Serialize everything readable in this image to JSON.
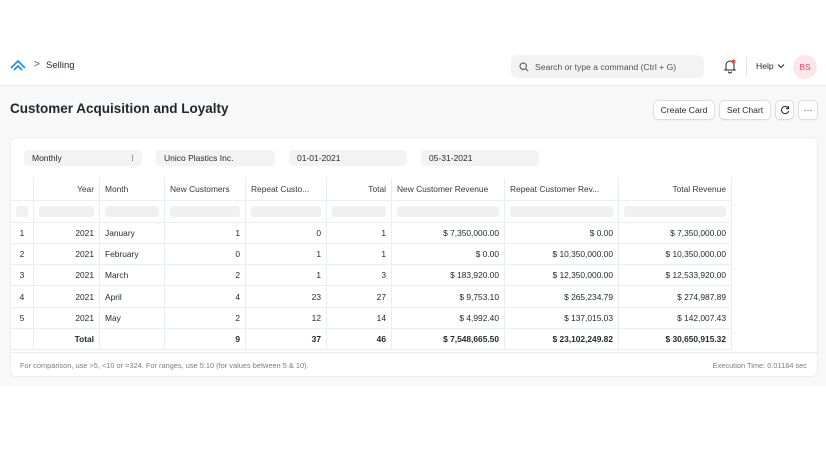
{
  "navbar": {
    "breadcrumb_sep": ">",
    "breadcrumb": "Selling",
    "search_placeholder": "Search or type a command (Ctrl + G)",
    "help_label": "Help",
    "avatar_initials": "BS"
  },
  "page": {
    "title": "Customer Acquisition and Loyalty",
    "buttons": {
      "create_card": "Create Card",
      "set_chart": "Set Chart",
      "more": "···"
    }
  },
  "filters": {
    "period": "Monthly",
    "period_indicator": "⁝",
    "company": "Unico Plastics Inc.",
    "from_date": "01-01-2021",
    "to_date": "05-31-2021"
  },
  "table": {
    "columns": [
      "Year",
      "Month",
      "New Customers",
      "Repeat Custo...",
      "Total",
      "New Customer Revenue",
      "Repeat Customer Rev...",
      "Total Revenue"
    ],
    "rows": [
      {
        "num": "1",
        "year": "2021",
        "month": "January",
        "new": "1",
        "repeat": "0",
        "total": "1",
        "new_rev": "$ 7,350,000.00",
        "repeat_rev": "$ 0.00",
        "total_rev": "$ 7,350,000.00"
      },
      {
        "num": "2",
        "year": "2021",
        "month": "February",
        "new": "0",
        "repeat": "1",
        "total": "1",
        "new_rev": "$ 0.00",
        "repeat_rev": "$ 10,350,000.00",
        "total_rev": "$ 10,350,000.00"
      },
      {
        "num": "3",
        "year": "2021",
        "month": "March",
        "new": "2",
        "repeat": "1",
        "total": "3",
        "new_rev": "$ 183,920.00",
        "repeat_rev": "$ 12,350,000.00",
        "total_rev": "$ 12,533,920.00"
      },
      {
        "num": "4",
        "year": "2021",
        "month": "April",
        "new": "4",
        "repeat": "23",
        "total": "27",
        "new_rev": "$ 9,753.10",
        "repeat_rev": "$ 265,234.79",
        "total_rev": "$ 274,987.89"
      },
      {
        "num": "5",
        "year": "2021",
        "month": "May",
        "new": "2",
        "repeat": "12",
        "total": "14",
        "new_rev": "$ 4,992.40",
        "repeat_rev": "$ 137,015.03",
        "total_rev": "$ 142,007.43"
      }
    ],
    "totals": {
      "label": "Total",
      "new": "9",
      "repeat": "37",
      "total": "46",
      "new_rev": "$ 7,548,665.50",
      "repeat_rev": "$ 23,102,249.82",
      "total_rev": "$ 30,650,915.32"
    }
  },
  "footer": {
    "note": "For comparison, use >5, <10 or =324. For ranges, use 5:10 (for values between 5 & 10).",
    "execution_time": "Execution Time: 0.01184 sec"
  },
  "colors": {
    "avatar_bg": "#fce6ea",
    "avatar_text": "#e24c6e",
    "logo": "#2490ef"
  },
  "icons": [
    "app-logo-icon",
    "search-icon",
    "bell-icon",
    "chevron-down-icon",
    "refresh-icon",
    "more-icon"
  ]
}
